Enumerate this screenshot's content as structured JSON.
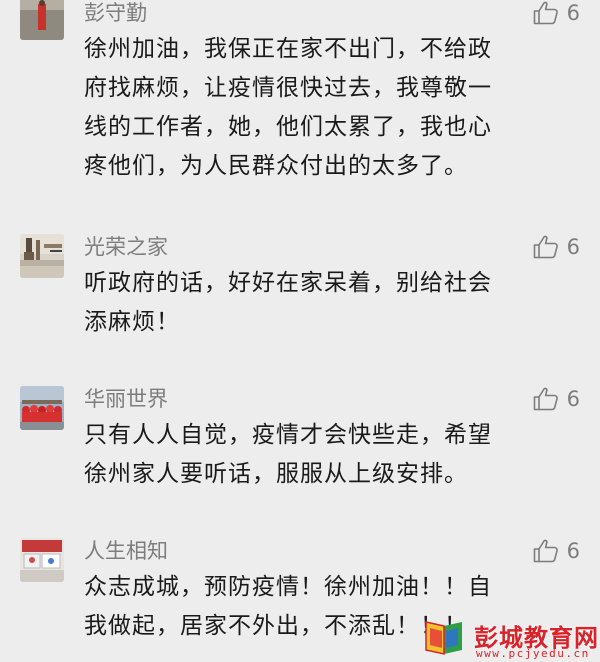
{
  "comments": [
    {
      "author": "彭守勤",
      "likes": "6",
      "text_lines": [
        "徐州加油，我保正在家不出门，不给政",
        "府找麻烦，让疫情很快过去，我尊敬一",
        "线的工作者，她，他们太累了，我也心",
        "疼他们，为人民群众付出的太多了。"
      ]
    },
    {
      "author": "光荣之家",
      "likes": "6",
      "text_lines": [
        "听政府的话，好好在家呆着，别给社会",
        "添麻烦！"
      ]
    },
    {
      "author": "华丽世界",
      "likes": "6",
      "text_lines": [
        "只有人人自觉，疫情才会快些走，希望",
        "徐州家人要听话，服服从上级安排。"
      ]
    },
    {
      "author": "人生相知",
      "likes": "6",
      "text_lines": [
        "众志成城，预防疫情！徐州加油！！自",
        "我做起，居家不外出，不添乱！！！"
      ]
    }
  ],
  "watermark": {
    "brand": "彭城教育网",
    "url": "www.pcjyedu.cn"
  },
  "colors": {
    "background": "#ededed",
    "meta_text": "#7d7d7d",
    "body_text": "#1a1a1a",
    "watermark_red": "#d8232a"
  },
  "icons": [
    "thumbs-up-icon"
  ]
}
